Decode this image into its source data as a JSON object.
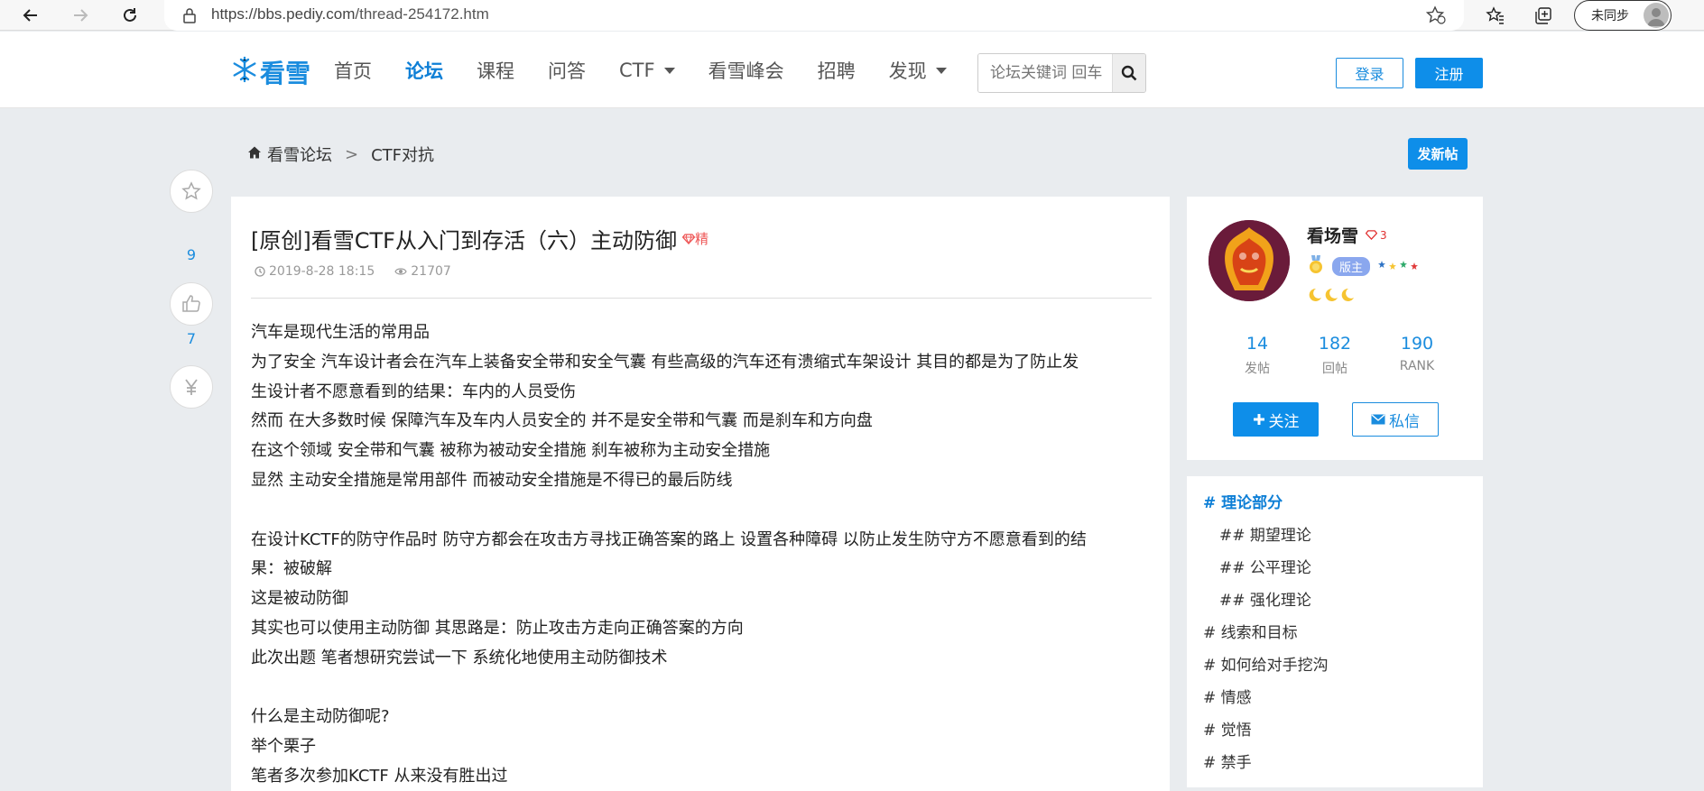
{
  "browser": {
    "url_host": "https://bbs.pediy.com",
    "url_path": "/thread-254172.htm",
    "sync_label": "未同步"
  },
  "site": {
    "logo_text": "看雪",
    "nav": [
      {
        "label": "首页"
      },
      {
        "label": "论坛"
      },
      {
        "label": "课程"
      },
      {
        "label": "问答"
      },
      {
        "label": "CTF"
      },
      {
        "label": "看雪峰会"
      },
      {
        "label": "招聘"
      },
      {
        "label": "发现"
      }
    ],
    "search_placeholder": "论坛关键词 回车",
    "login_label": "登录",
    "register_label": "注册"
  },
  "breadcrumb": {
    "home": "看雪论坛",
    "sep": ">",
    "current": "CTF对抗"
  },
  "new_post_label": "发新帖",
  "side_actions": {
    "star_count": "9",
    "like_count": "7"
  },
  "post": {
    "title": "[原创]看雪CTF从入门到存活（六）主动防御",
    "badge": "精",
    "date": "2019-8-28 18:15",
    "views": "21707",
    "lines": [
      "汽车是现代生活的常用品",
      "为了安全 汽车设计者会在汽车上装备安全带和安全气囊 有些高级的汽车还有溃缩式车架设计 其目的都是为了防止发",
      "生设计者不愿意看到的结果：车内的人员受伤",
      "然而 在大多数时候 保障汽车及车内人员安全的 并不是安全带和气囊 而是刹车和方向盘",
      "在这个领域 安全带和气囊 被称为被动安全措施 刹车被称为主动安全措施",
      "显然 主动安全措施是常用部件 而被动安全措施是不得已的最后防线",
      "",
      "在设计KCTF的防守作品时 防守方都会在攻击方寻找正确答案的路上 设置各种障碍 以防止发生防守方不愿意看到的结",
      "果：被破解",
      "这是被动防御",
      "其实也可以使用主动防御 其思路是：防止攻击方走向正确答案的方向",
      "此次出题 笔者想研究尝试一下 系统化地使用主动防御技术",
      "",
      "什么是主动防御呢?",
      "举个栗子",
      "笔者多次参加KCTF 从来没有胜出过"
    ]
  },
  "author": {
    "name": "看场雪",
    "level": "3",
    "role": "版主",
    "stats": [
      {
        "num": "14",
        "label": "发帖"
      },
      {
        "num": "182",
        "label": "回帖"
      },
      {
        "num": "190",
        "label": "RANK"
      }
    ],
    "follow_label": "关注",
    "message_label": "私信"
  },
  "toc": [
    {
      "label": "# 理论部分"
    },
    {
      "label": "## 期望理论"
    },
    {
      "label": "## 公平理论"
    },
    {
      "label": "## 强化理论"
    },
    {
      "label": "# 线索和目标"
    },
    {
      "label": "# 如何给对手挖沟"
    },
    {
      "label": "# 情感"
    },
    {
      "label": "# 觉悟"
    },
    {
      "label": "# 禁手"
    }
  ],
  "colors": {
    "accent": "#0e8ee9",
    "link": "#1a8cde",
    "background": "#e9ecef"
  }
}
